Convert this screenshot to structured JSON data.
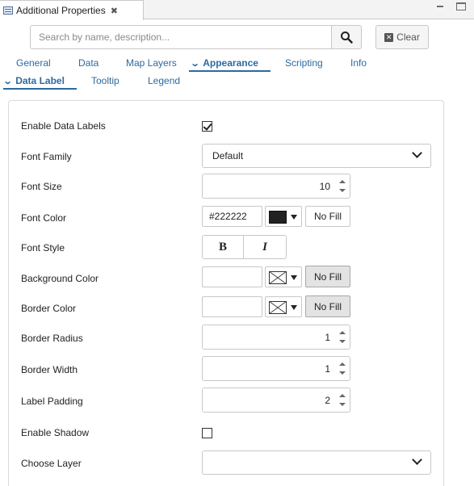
{
  "view": {
    "title": "Additional Properties",
    "close_glyph": "✖"
  },
  "search": {
    "placeholder": "Search by name, description...",
    "value": "",
    "clear_label": "Clear"
  },
  "main_tabs": [
    {
      "label": "General"
    },
    {
      "label": "Data"
    },
    {
      "label": "Map Layers"
    },
    {
      "label": "Appearance",
      "active": true
    },
    {
      "label": "Scripting"
    },
    {
      "label": "Info"
    }
  ],
  "sub_tabs": [
    {
      "label": "Data Label",
      "active": true
    },
    {
      "label": "Tooltip"
    },
    {
      "label": "Legend"
    }
  ],
  "form": {
    "enable_data_labels": {
      "label": "Enable Data Labels",
      "checked": true
    },
    "font_family": {
      "label": "Font Family",
      "value": "Default"
    },
    "font_size": {
      "label": "Font Size",
      "value": "10"
    },
    "font_color": {
      "label": "Font Color",
      "value": "#222222",
      "swatch": "#222222",
      "nofill_label": "No Fill"
    },
    "font_style": {
      "label": "Font Style",
      "bold_glyph": "B",
      "italic_glyph": "I"
    },
    "background_color": {
      "label": "Background Color",
      "value": "",
      "nofill_label": "No Fill"
    },
    "border_color": {
      "label": "Border Color",
      "value": "",
      "nofill_label": "No Fill"
    },
    "border_radius": {
      "label": "Border Radius",
      "value": "1"
    },
    "border_width": {
      "label": "Border Width",
      "value": "1"
    },
    "label_padding": {
      "label": "Label Padding",
      "value": "2"
    },
    "enable_shadow": {
      "label": "Enable Shadow",
      "checked": false
    },
    "choose_layer": {
      "label": "Choose Layer",
      "value": ""
    }
  },
  "colors": {
    "accent": "#2c6aa0",
    "font_swatch": "#222222"
  }
}
